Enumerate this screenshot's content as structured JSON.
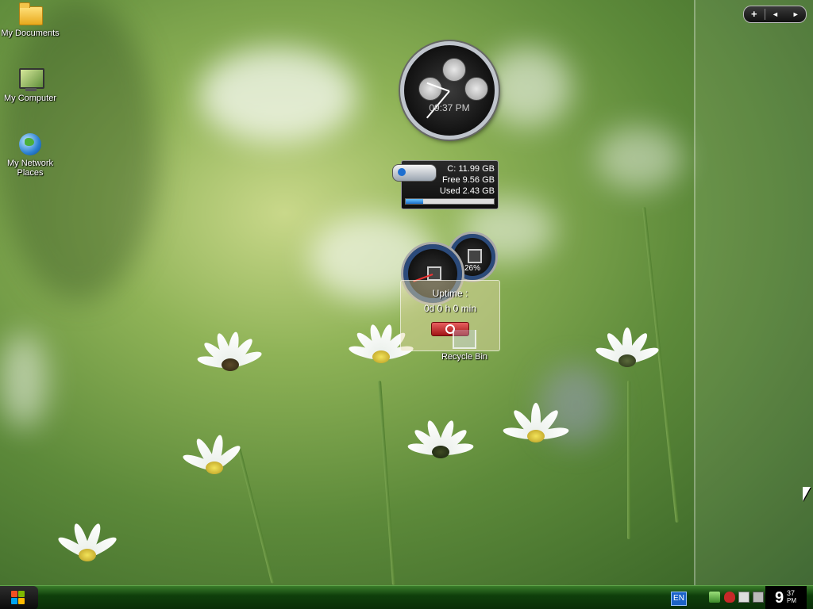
{
  "desktop_icons": [
    {
      "label": "My Documents"
    },
    {
      "label": "My Computer"
    },
    {
      "label": "My Network Places"
    },
    {
      "label": "Recycle Bin"
    }
  ],
  "sidebar": {
    "add_label": "+",
    "prev_label": "◄",
    "next_label": "►"
  },
  "clock_gadget": {
    "time": "09:37 PM"
  },
  "drive_gadget": {
    "drive_line": "C:  11.99 GB",
    "free_line": "Free 9.56 GB",
    "used_line": "Used 2.43 GB",
    "used_fraction": 0.2
  },
  "meter_gadget": {
    "cpu_percent_label": "26%"
  },
  "uptime_gadget": {
    "title": "Uptime :",
    "value": "0d 0 h 0 min"
  },
  "taskbar": {
    "language": "EN",
    "clock_hour": "9",
    "clock_minutes": "37",
    "clock_ampm": "PM"
  },
  "colors": {
    "taskbar": "#0f3f0b",
    "accent_blue": "#1a6ec8",
    "shutdown_red": "#a11414"
  }
}
